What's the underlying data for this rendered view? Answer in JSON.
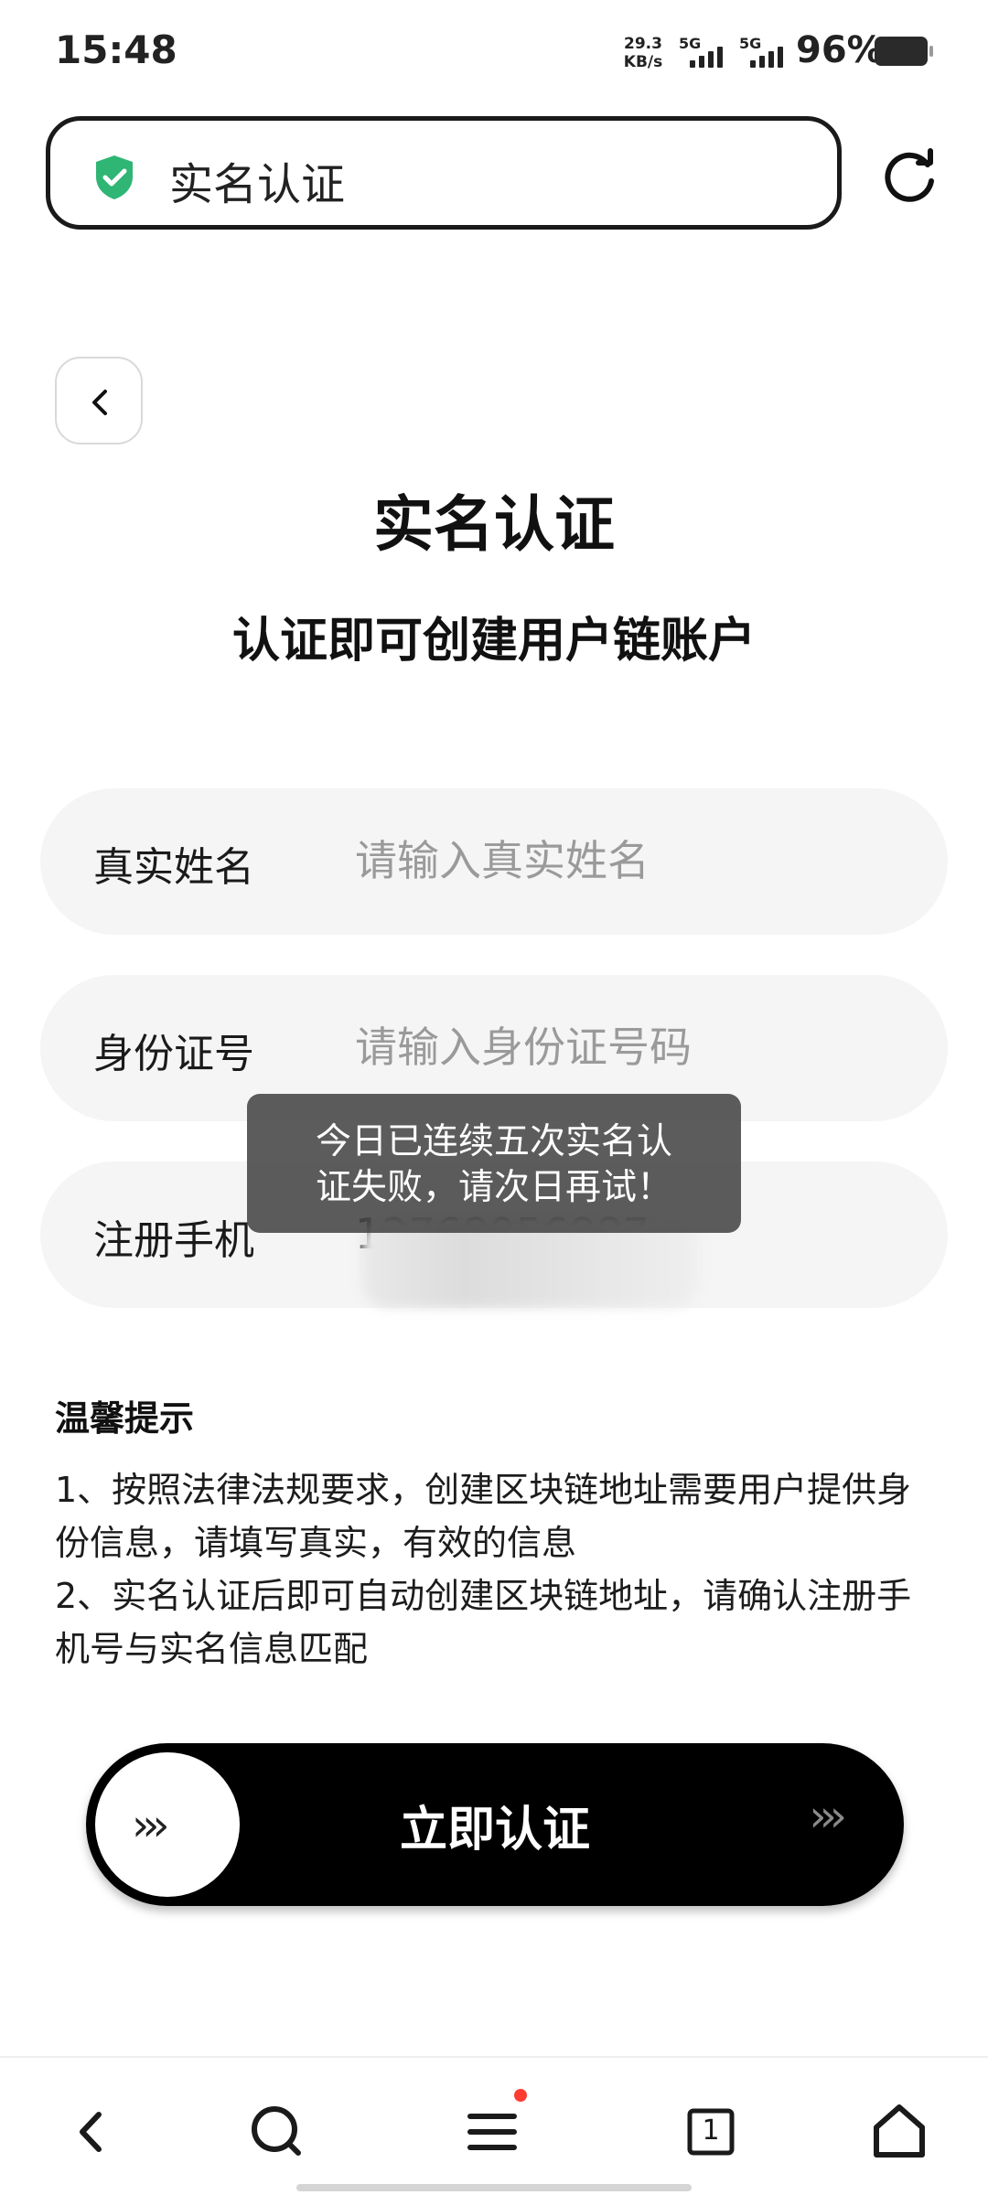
{
  "status_bar": {
    "time": "15:48",
    "net_speed_value": "29.3",
    "net_speed_unit": "KB/s",
    "sim1": "5G",
    "sim2": "5G",
    "battery": "96%"
  },
  "address_bar": {
    "title": "实名认证",
    "security_icon": "shield-check-icon",
    "accent_color": "#2fb574"
  },
  "page": {
    "title": "实名认证",
    "subtitle": "认证即可创建用户链账户"
  },
  "form": {
    "name": {
      "label": "真实姓名",
      "placeholder": "请输入真实姓名",
      "value": ""
    },
    "id_number": {
      "label": "身份证号",
      "placeholder": "请输入身份证号码",
      "value": ""
    },
    "phone": {
      "label": "注册手机",
      "placeholder": "",
      "value": "12768056887"
    }
  },
  "toast": {
    "line1": "今日已连续五次实名认",
    "line2": "证失败，请次日再试！"
  },
  "tips": {
    "title": "温馨提示",
    "items": [
      "1、按照法律法规要求，创建区块链地址需要用户提供身份信息，请填写真实，有效的信息",
      "2、实名认证后即可自动创建区块链地址，请确认注册手机号与实名信息匹配"
    ]
  },
  "submit": {
    "label": "立即认证",
    "knob_arrows": "›››",
    "trail_arrows": "›››"
  },
  "bottom_nav": {
    "tab_count": "1",
    "items": [
      "back-icon",
      "search-icon",
      "menu-icon",
      "tabs-icon",
      "home-icon"
    ]
  }
}
